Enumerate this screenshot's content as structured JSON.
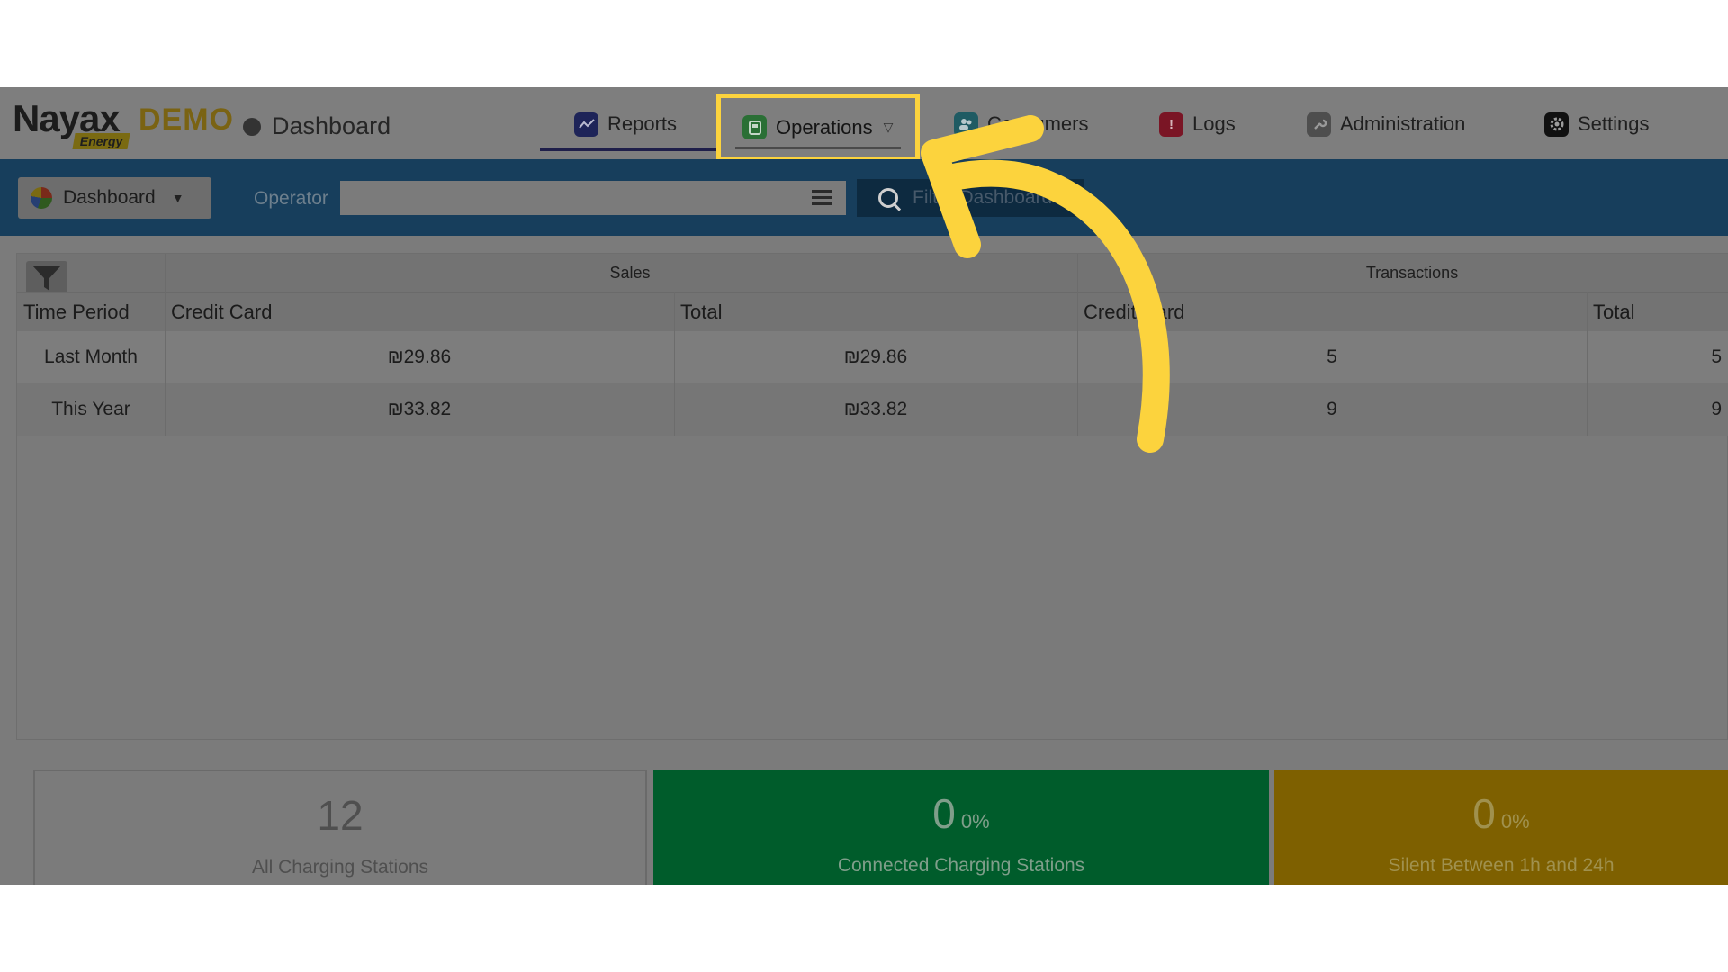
{
  "brand": {
    "name": "Nayax",
    "demo": "DEMO",
    "sub": "Energy"
  },
  "page_title": "Dashboard",
  "nav": {
    "reports": "Reports",
    "operations": "Operations",
    "consumers": "Consumers",
    "logs": "Logs",
    "administration": "Administration",
    "settings": "Settings"
  },
  "filter": {
    "dashboard_select": "Dashboard",
    "operator_label": "Operator",
    "operator_value": "",
    "filter_button": "Filter Dashboard"
  },
  "table": {
    "groups": [
      "Sales",
      "Transactions"
    ],
    "columns": [
      "Time Period",
      "Credit Card",
      "Total",
      "Credit Card",
      "Total"
    ],
    "rows": [
      {
        "period": "Last Month",
        "sales_cc": "₪29.86",
        "sales_total": "₪29.86",
        "tx_cc": "5",
        "tx_total": "5"
      },
      {
        "period": "This Year",
        "sales_cc": "₪33.82",
        "sales_total": "₪33.82",
        "tx_cc": "9",
        "tx_total": "9"
      }
    ]
  },
  "cards": {
    "all": {
      "value": "12",
      "label": "All Charging Stations"
    },
    "connected": {
      "value": "0",
      "percent": "0%",
      "label": "Connected Charging Stations"
    },
    "silent": {
      "value": "0",
      "percent": "0%",
      "label": "Silent Between 1h and 24h"
    }
  },
  "colors": {
    "highlight": "#fcd33d",
    "filter_bar": "#173e5c",
    "connected_card": "#005c2b",
    "silent_card": "#7e6000"
  }
}
